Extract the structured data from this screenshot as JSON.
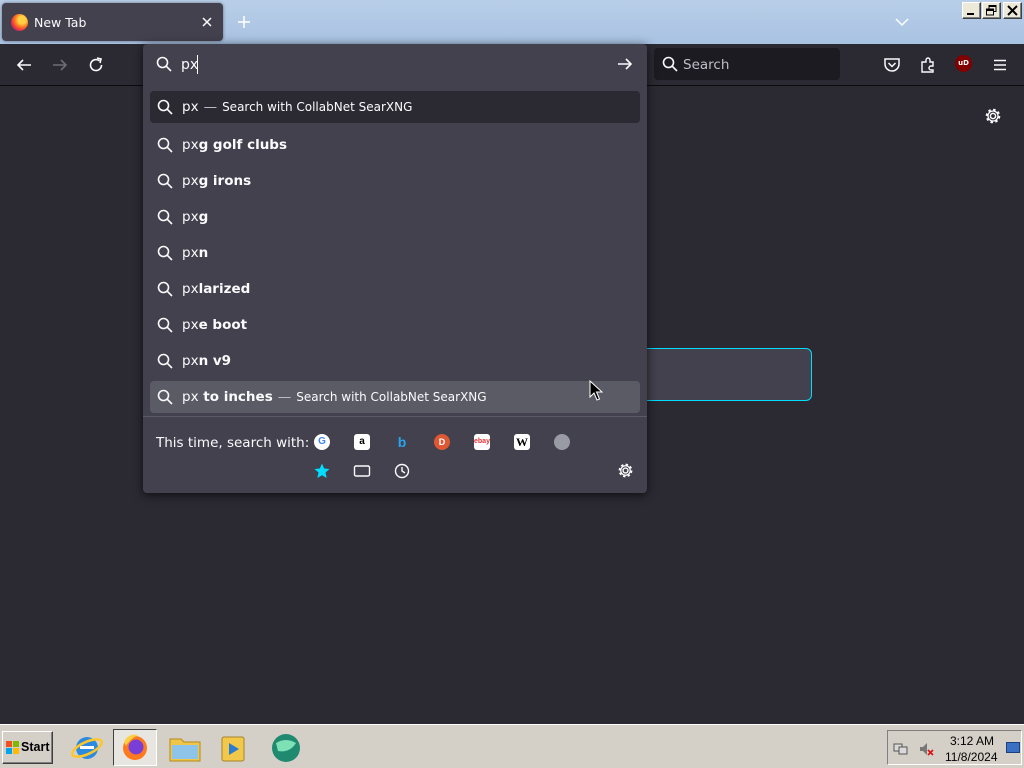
{
  "browser": {
    "tab": {
      "title": "New Tab"
    },
    "search_bar": {
      "placeholder": "Search"
    },
    "ublock_badge": "uD"
  },
  "urlbar": {
    "value": "px",
    "suggestions": [
      {
        "typed": "px",
        "completion": "",
        "action": "Search with CollabNet SearXNG",
        "state": "selected"
      },
      {
        "typed": "px",
        "completion": "g golf clubs"
      },
      {
        "typed": "px",
        "completion": "g irons"
      },
      {
        "typed": "px",
        "completion": "g"
      },
      {
        "typed": "px",
        "completion": "n"
      },
      {
        "typed": "px",
        "completion": "larized"
      },
      {
        "typed": "px",
        "completion": "e boot"
      },
      {
        "typed": "px",
        "completion": "n v9"
      },
      {
        "typed": "px",
        "completion": " to inches",
        "action": "Search with CollabNet SearXNG",
        "state": "hover"
      }
    ],
    "oneoff_label": "This time, search with:",
    "engines": [
      "google-icon",
      "amazon-icon",
      "bing-icon",
      "duckduckgo-icon",
      "ebay-icon",
      "wikipedia-icon",
      "searxng-icon"
    ],
    "modes": [
      "bookmarks-icon",
      "tabs-icon",
      "history-icon"
    ]
  },
  "taskbar": {
    "start_label": "Start",
    "clock_time": "3:12 AM",
    "clock_date": "11/8/2024"
  },
  "colors": {
    "focus_ring": "#00ddff",
    "toolbar": "#2b2a33",
    "panel": "#42414d"
  }
}
